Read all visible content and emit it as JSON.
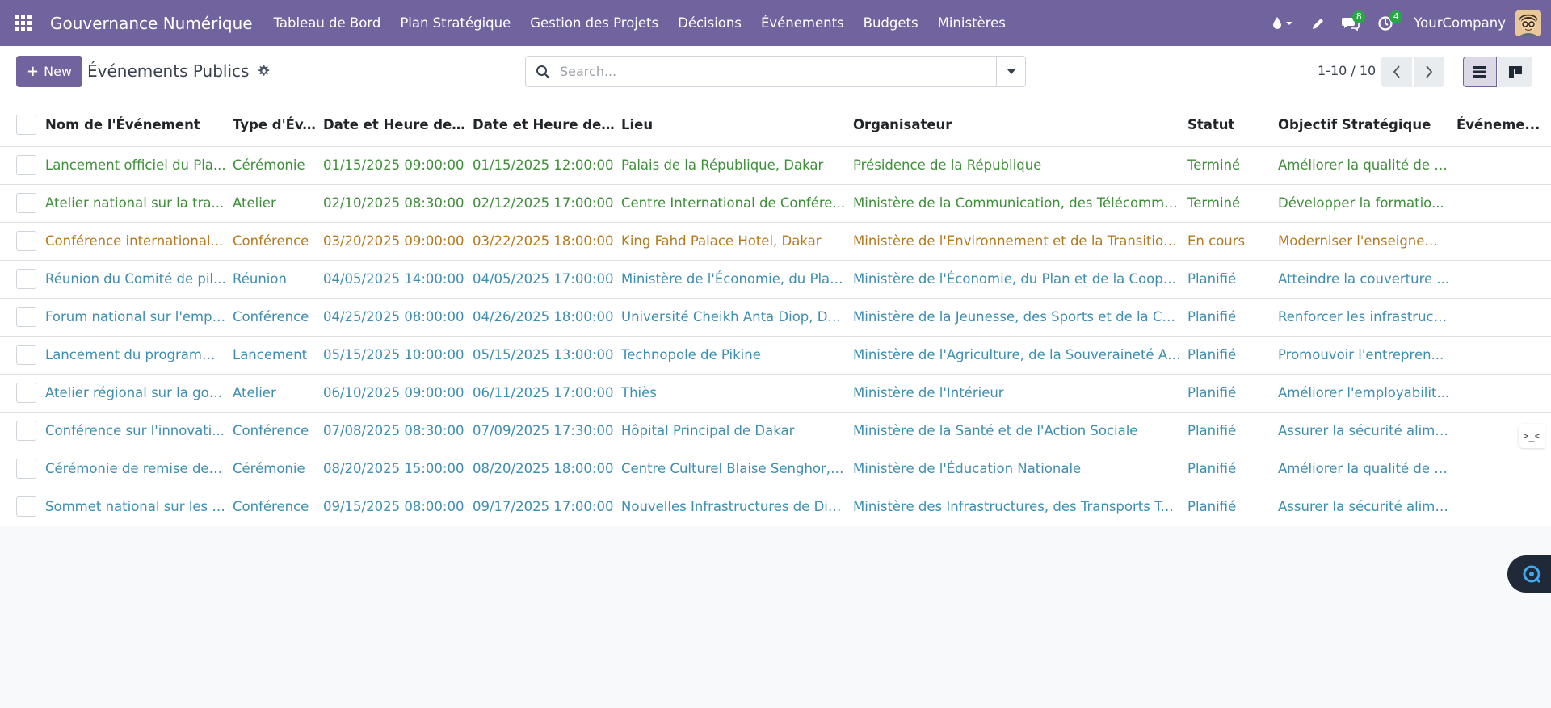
{
  "navbar": {
    "brand": "Gouvernance Numérique",
    "menu": [
      "Tableau de Bord",
      "Plan Stratégique",
      "Gestion des Projets",
      "Décisions",
      "Événements",
      "Budgets",
      "Ministères"
    ],
    "messages_count": "8",
    "activities_count": "4",
    "company": "YourCompany",
    "accent_color": "#71639e"
  },
  "control": {
    "new_label": "New",
    "breadcrumb": "Événements Publics",
    "search_placeholder": "Search...",
    "pager": "1-10 / 10"
  },
  "table": {
    "columns": [
      "Nom de l'Événement",
      "Type d'Év...",
      "Date et Heure de D...",
      "Date et Heure de Fin",
      "Lieu",
      "Organisateur",
      "Statut",
      "Objectif Stratégique",
      "Événeme..."
    ],
    "rows": [
      {
        "status_color": "green",
        "cells": [
          "Lancement officiel du Pla...",
          "Cérémonie",
          "01/15/2025 09:00:00",
          "01/15/2025 12:00:00",
          "Palais de la République, Dakar",
          "Présidence de la République",
          "Terminé",
          "Améliorer la qualité de l'...",
          ""
        ]
      },
      {
        "status_color": "green",
        "cells": [
          "Atelier national sur la tra...",
          "Atelier",
          "02/10/2025 08:30:00",
          "02/12/2025 17:00:00",
          "Centre International de Confére...",
          "Ministère de la Communication, des Télécommu...",
          "Terminé",
          "Développer la formatio...",
          ""
        ]
      },
      {
        "status_color": "orange",
        "cells": [
          "Conférence international...",
          "Conférence",
          "03/20/2025 09:00:00",
          "03/22/2025 18:00:00",
          "King Fahd Palace Hotel, Dakar",
          "Ministère de l'Environnement et de la Transition ...",
          "En cours",
          "Moderniser l'enseignem...",
          ""
        ]
      },
      {
        "status_color": "blue",
        "cells": [
          "Réunion du Comité de pil...",
          "Réunion",
          "04/05/2025 14:00:00",
          "04/05/2025 17:00:00",
          "Ministère de l'Économie, du Plan...",
          "Ministère de l'Économie, du Plan et de la Coopér...",
          "Planifié",
          "Atteindre la couverture ...",
          ""
        ]
      },
      {
        "status_color": "blue",
        "cells": [
          "Forum national sur l'empl...",
          "Conférence",
          "04/25/2025 08:00:00",
          "04/26/2025 18:00:00",
          "Université Cheikh Anta Diop, Dakar",
          "Ministère de la Jeunesse, des Sports et de la Cult...",
          "Planifié",
          "Renforcer les infrastruct...",
          ""
        ]
      },
      {
        "status_color": "blue",
        "cells": [
          "Lancement du programm...",
          "Lancement",
          "05/15/2025 10:00:00",
          "05/15/2025 13:00:00",
          "Technopole de Pikine",
          "Ministère de l'Agriculture, de la Souveraineté Ali...",
          "Planifié",
          "Promouvoir l'entrepren...",
          ""
        ]
      },
      {
        "status_color": "blue",
        "cells": [
          "Atelier régional sur la gou...",
          "Atelier",
          "06/10/2025 09:00:00",
          "06/11/2025 17:00:00",
          "Thiès",
          "Ministère de l'Intérieur",
          "Planifié",
          "Améliorer l'employabilit...",
          ""
        ]
      },
      {
        "status_color": "blue",
        "cells": [
          "Conférence sur l'innovati...",
          "Conférence",
          "07/08/2025 08:30:00",
          "07/09/2025 17:30:00",
          "Hôpital Principal de Dakar",
          "Ministère de la Santé et de l'Action Sociale",
          "Planifié",
          "Assurer la sécurité alime...",
          ""
        ]
      },
      {
        "status_color": "blue",
        "cells": [
          "Cérémonie de remise des ...",
          "Cérémonie",
          "08/20/2025 15:00:00",
          "08/20/2025 18:00:00",
          "Centre Culturel Blaise Senghor, ...",
          "Ministère de l'Éducation Nationale",
          "Planifié",
          "Améliorer la qualité de l'...",
          ""
        ]
      },
      {
        "status_color": "blue",
        "cells": [
          "Sommet national sur les i...",
          "Conférence",
          "09/15/2025 08:00:00",
          "09/17/2025 17:00:00",
          "Nouvelles Infrastructures de Dia...",
          "Ministère des Infrastructures, des Transports Ter...",
          "Planifié",
          "Assurer la sécurité alime...",
          ""
        ]
      }
    ]
  },
  "colors": {
    "green": "#3f8f3a",
    "orange": "#b7791f",
    "blue": "#3d8eb0"
  }
}
